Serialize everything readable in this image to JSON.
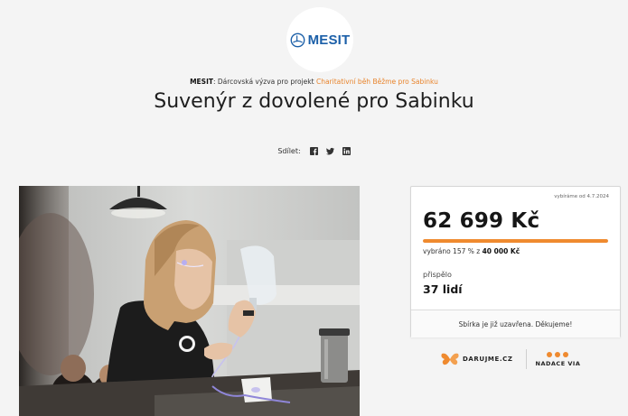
{
  "brand": {
    "logo_text": "MESIT",
    "logo_color": "#1b5fa8"
  },
  "breadcrumb": {
    "organization": "MESIT",
    "middle": ": Dárcovská výzva pro projekt ",
    "project_link": "Charitativní běh Běžme pro Sabinku"
  },
  "title": "Suvenýr z dovolené pro Sabinku",
  "share": {
    "label": "Sdílet:",
    "icons": [
      "facebook-icon",
      "twitter-icon",
      "linkedin-icon"
    ]
  },
  "campaign": {
    "since": "vybíráme od 4.7.2024",
    "amount": "62 699 Kč",
    "progress_fraction": 1.0,
    "collected_prefix": "vybráno 157 % z ",
    "goal": "40 000 Kč",
    "contributors_label": "přispělo",
    "contributors": "37 lidí",
    "closed_message": "Sbírka je již uzavřena. Děkujeme!"
  },
  "partners": {
    "darujme": "DARUJME.CZ",
    "via": "NADACE VIA"
  },
  "colors": {
    "accent": "#ef8a2f",
    "link": "#e8842c",
    "background": "#f4f4f4"
  }
}
